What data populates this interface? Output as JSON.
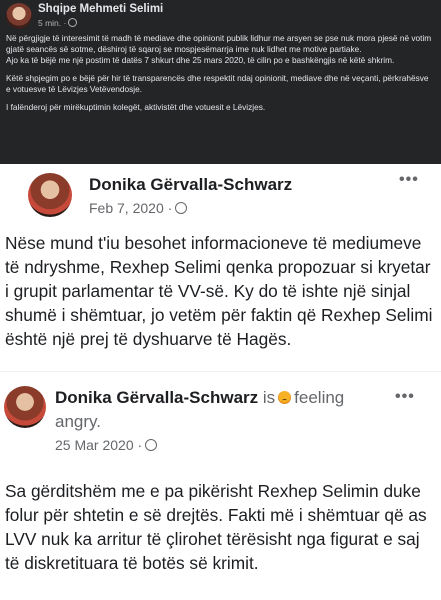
{
  "header_post": {
    "author": "Shqipe Mehmeti Selimi",
    "time": "5 min. ·",
    "paragraphs": [
      "Në përgjigje të interesimit të madh të mediave dhe opinionit publik lidhur me arsyen se pse nuk mora pjesë në votim gjatë seancës së sotme, dëshiroj të sqaroj se mospjesëmarrja ime nuk lidhet me motive partiake.",
      "Ajo ka të bëjë me një postim të datës 7 shkurt dhe 25 mars 2020, të cilin po e bashkëngjis në këtë shkrim.",
      "Këtë shpjegim po e bëjë për hir të transparencës dhe respektit ndaj opinionit, mediave dhe në veçanti, përkrahësve e votuesve të Lëvizjes Vetëvendosje.",
      "I falënderoj për mirëkuptimin kolegët, aktivistët dhe votuesit e Lëvizjes."
    ]
  },
  "post1": {
    "author": "Donika Gërvalla-Schwarz",
    "date": "Feb 7, 2020 ·",
    "text": "Nëse mund t'iu besohet informacioneve të mediumeve të ndryshme, Rexhep Selimi qenka propozuar si kryetar i grupit parlamentar të VV-së. Ky do të ishte një sinjal shumë i shëmtuar, jo vetëm për faktin që Rexhep Selimi është një prej të dyshuarve të Hagës."
  },
  "post2": {
    "author": "Donika Gërvalla-Schwarz",
    "is_text": "is",
    "feeling": "feeling",
    "feeling_value": "angry.",
    "date": "25 Mar 2020 ·",
    "text": "Sa gërditshëm me e pa pikërisht Rexhep Selimin duke folur për shtetin e së drejtës. Fakti më i shëmtuar që as LVV nuk ka arritur të çlirohet tërësisht nga figurat e saj të diskretituara të botës së krimit."
  },
  "icons": {
    "more": "more-options-icon",
    "privacy": "globe-icon",
    "mood": "angry-emoji-icon"
  }
}
